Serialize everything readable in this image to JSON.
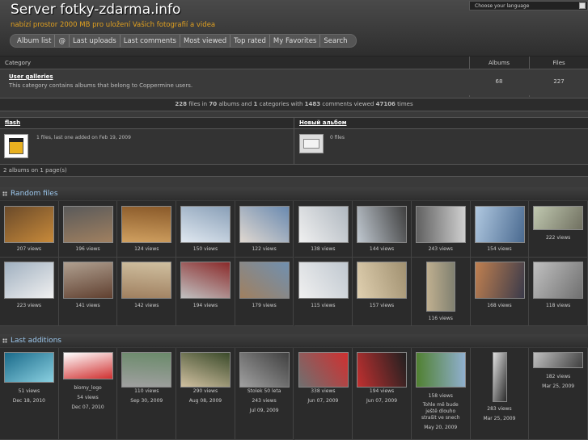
{
  "header": {
    "title": "Server fotky-zdarma.info",
    "subtitle": "nabízí prostor 2000 MB pro uložení Vašich fotografií a videa",
    "language_label": "Choose your language"
  },
  "nav": [
    "Album list",
    "@",
    "Last uploads",
    "Last comments",
    "Most viewed",
    "Top rated",
    "My Favorites",
    "Search"
  ],
  "categories": {
    "col_category": "Category",
    "col_albums": "Albums",
    "col_files": "Files",
    "rows": [
      {
        "name": "User galleries",
        "desc": "This category contains albums that belong to Coppermine users.",
        "albums": "68",
        "files": "227"
      }
    ]
  },
  "stats": {
    "files": "228",
    "t1": " files in ",
    "albums": "70",
    "t2": " albums and ",
    "cats": "1",
    "t3": " categories with ",
    "comments": "1483",
    "t4": " comments viewed ",
    "views": "47106",
    "t5": " times"
  },
  "albums": [
    {
      "name": "flash",
      "info": "1 files, last one added on Feb 19, 2009"
    },
    {
      "name": "Новый альбом",
      "info": "0 files"
    }
  ],
  "albums_pages": "2 albums on 1 page(s)",
  "random": {
    "title": "Random files",
    "row1": [
      "207 views",
      "196 views",
      "124 views",
      "150 views",
      "122 views",
      "138 views",
      "144 views",
      "243 views",
      "154 views",
      "222 views"
    ],
    "row2": [
      "223 views",
      "141 views",
      "142 views",
      "194 views",
      "179 views",
      "115 views",
      "157 views",
      "116 views",
      "168 views",
      "118 views"
    ]
  },
  "last": {
    "title": "Last additions",
    "items": [
      {
        "title": "",
        "views": "51 views",
        "date": "Dec 18, 2010"
      },
      {
        "title": "biomy_logo",
        "views": "54 views",
        "date": "Dec 07, 2010"
      },
      {
        "title": "",
        "views": "110 views",
        "date": "Sep 30, 2009"
      },
      {
        "title": "",
        "views": "290 views",
        "date": "Aug 08, 2009"
      },
      {
        "title": "Stolek 50 leta",
        "views": "243 views",
        "date": "Jul 09, 2009"
      },
      {
        "title": "",
        "views": "338 views",
        "date": "Jun 07, 2009"
      },
      {
        "title": "",
        "views": "194 views",
        "date": "Jun 07, 2009"
      },
      {
        "title": "Tohle mě bude ještě dlouho strašit ve snech",
        "views": "158 views",
        "date": "May 20, 2009"
      },
      {
        "title": "",
        "views": "283 views",
        "date": "Mar 25, 2009"
      },
      {
        "title": "",
        "views": "182 views",
        "date": "Mar 25, 2009"
      }
    ]
  },
  "colors": {
    "accent": "#e0a020",
    "link_blue": "#9cc8ee",
    "background": "#3a3a3a"
  }
}
